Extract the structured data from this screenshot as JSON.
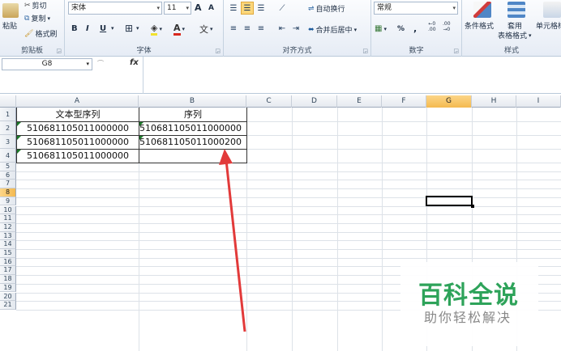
{
  "ribbon": {
    "clipboard": {
      "paste_label": "粘贴",
      "cut_label": "剪切",
      "copy_label": "复制",
      "format_painter_label": "格式刷",
      "group_label": "剪贴板"
    },
    "font": {
      "font_name": "宋体",
      "font_size": "11",
      "grow_label": "A",
      "shrink_label": "A",
      "bold_label": "B",
      "italic_label": "I",
      "underline_label": "U",
      "group_label": "字体",
      "fill_label": "A",
      "wen_label": "文"
    },
    "alignment": {
      "wrap_label": "自动换行",
      "merge_label": "合并后居中",
      "group_label": "对齐方式"
    },
    "number": {
      "format_value": "常规",
      "percent_label": "%",
      "comma_label": ",",
      "inc_decimal_label": ".00",
      "dec_decimal_label": ".00",
      "group_label": "数字"
    },
    "styles": {
      "conditional_label": "条件格式",
      "table_label_1": "套用",
      "table_label_2": "表格格式",
      "cell_styles_label": "单元格样",
      "group_label": "样式"
    }
  },
  "formula_bar": {
    "name_box": "G8",
    "fx_label": "fx",
    "content": ""
  },
  "sheet": {
    "columns": [
      "A",
      "B",
      "C",
      "D",
      "E",
      "F",
      "G",
      "H",
      "I"
    ],
    "rows": [
      "1",
      "2",
      "3",
      "4",
      "5",
      "6",
      "7",
      "8",
      "9",
      "10",
      "11",
      "12",
      "13",
      "14",
      "15",
      "16",
      "17",
      "18",
      "19",
      "20",
      "21"
    ],
    "active_column": "G",
    "active_row": "8",
    "cells": {
      "A1": "文本型序列",
      "B1": "序列",
      "A2": "510681105011000000",
      "B2": "510681105011000000",
      "A3": "510681105011000000",
      "B3": "510681105011000200",
      "A4": "510681105011000000",
      "B4": ""
    }
  },
  "annotation": {
    "arrow_color": "#e23a3a"
  },
  "watermark": {
    "title": "百科全说",
    "subtitle": "助你轻松解决",
    "title_color": "#2ea35a"
  }
}
